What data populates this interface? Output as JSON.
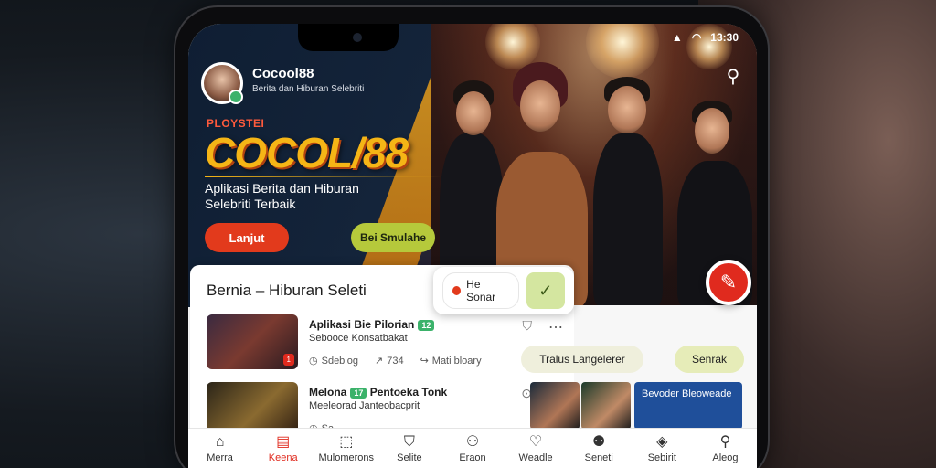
{
  "status": {
    "time": "13:30"
  },
  "profile": {
    "name": "Cocool88",
    "subtitle": "Berita dan Hiburan Selebriti"
  },
  "hero": {
    "kicker": "PLOYSTEI",
    "title": "COCOL/88",
    "tagline": "Aplikasi Berita dan Hiburan Selebriti Terbaik",
    "primary_button": "Lanjut",
    "secondary_button": "Bei Smulahe"
  },
  "section": {
    "title": "Bernia – Hiburan Seleti"
  },
  "popup": {
    "pill_label": "He Sonar",
    "square_glyph": "✓"
  },
  "cards": [
    {
      "title": "Aplikasi Bie Pilorian",
      "chip": "12",
      "subtitle": "Sebooce Konsatbakat",
      "meta_a": "Sdeblog",
      "meta_b": "734",
      "meta_c": "Mati bloary",
      "tag": "1"
    },
    {
      "title": "Melona",
      "chip": "17",
      "title2": "Pentoeka Tonk",
      "subtitle": "Meeleorad Janteobacprit",
      "meta_a": "Sa",
      "meta_b": "",
      "meta_c": "",
      "tag": ""
    }
  ],
  "right": {
    "pill_a": "Tralus Langelerer",
    "pill_b": "Senrak",
    "tile_text": "Bevoder Bleoweade"
  },
  "tabs": [
    {
      "label": "Merra",
      "icon": "home-icon"
    },
    {
      "label": "Keena",
      "icon": "news-icon"
    },
    {
      "label": "Mulomerons",
      "icon": "trending-icon"
    },
    {
      "label": "Selite",
      "icon": "bookmark-icon"
    },
    {
      "label": "Eraon",
      "icon": "user-icon"
    },
    {
      "label": "Weadle",
      "icon": "heart-icon"
    },
    {
      "label": "Seneti",
      "icon": "notifications-icon"
    },
    {
      "label": "Sebirit",
      "icon": "gift-icon"
    },
    {
      "label": "Aleog",
      "icon": "profile-icon"
    }
  ]
}
